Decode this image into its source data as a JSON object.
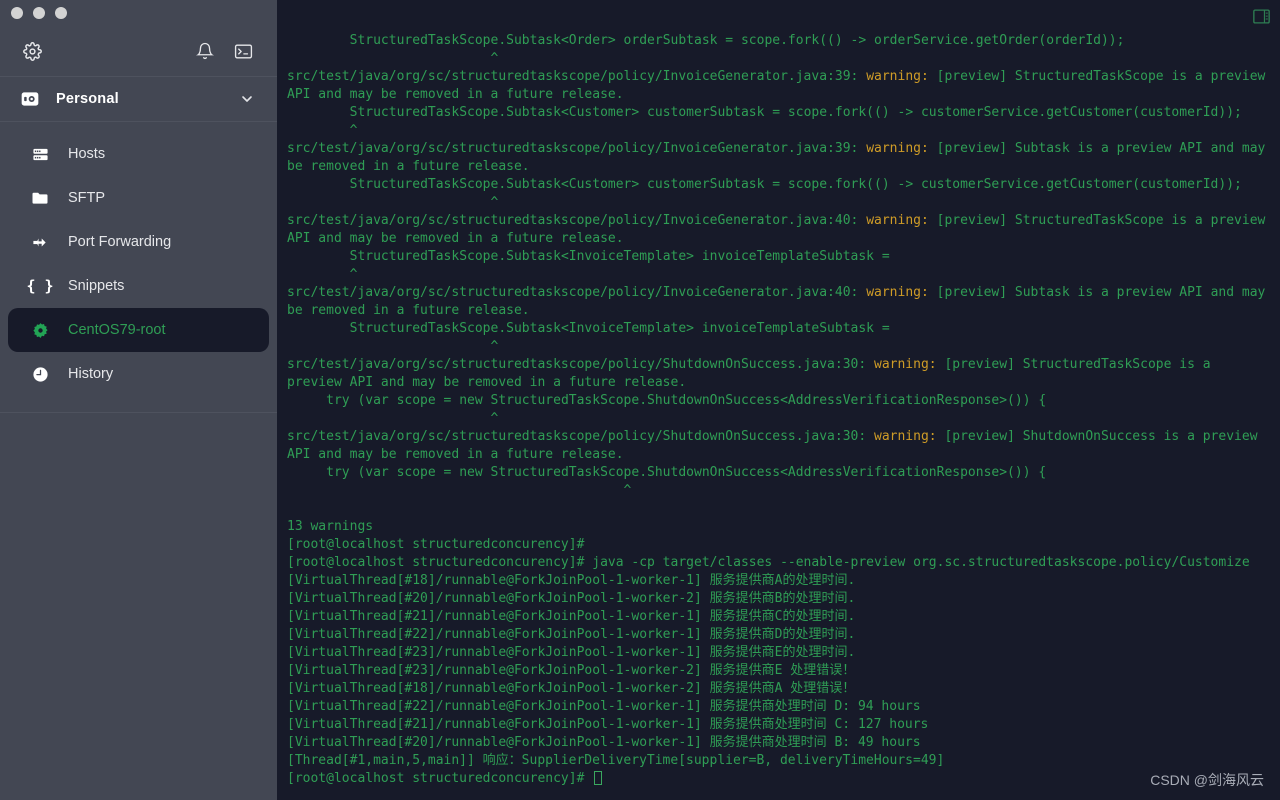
{
  "window": {
    "traffic_lights": [
      "close",
      "minimize",
      "zoom"
    ]
  },
  "sidebar": {
    "toolbar": {
      "settings_icon": "gear-icon",
      "notifications_icon": "bell-icon",
      "terminal_icon": "terminal-icon"
    },
    "account": {
      "label": "Personal",
      "icon": "vault-icon",
      "chevron": "chevron-down-icon"
    },
    "items": [
      {
        "label": "Hosts",
        "icon": "server-icon",
        "active": false
      },
      {
        "label": "SFTP",
        "icon": "folder-icon",
        "active": false
      },
      {
        "label": "Port Forwarding",
        "icon": "port-forwarding-icon",
        "active": false
      },
      {
        "label": "Snippets",
        "icon": "braces-icon",
        "active": false
      },
      {
        "label": "CentOS79-root",
        "icon": "gear-solid-icon",
        "active": true
      },
      {
        "label": "History",
        "icon": "clock-icon",
        "active": false
      }
    ]
  },
  "terminal": {
    "split_icon": "split-pane-icon",
    "colors": {
      "background": "#171a29",
      "foreground": "#2f9e55",
      "warning": "#cf9c27"
    },
    "lines": [
      {
        "text": "        StructuredTaskScope.Subtask<Order> orderSubtask = scope.fork(() -> orderService.getOrder(orderId));"
      },
      {
        "text": "                          ^"
      },
      {
        "text": "src/test/java/org/sc/structuredtaskscope/policy/InvoiceGenerator.java:39: ",
        "warn": "warning:",
        "rest": " [preview] StructuredTaskScope is a preview API and may be removed in a future release."
      },
      {
        "text": "        StructuredTaskScope.Subtask<Customer> customerSubtask = scope.fork(() -> customerService.getCustomer(customerId));"
      },
      {
        "text": "        ^"
      },
      {
        "text": "src/test/java/org/sc/structuredtaskscope/policy/InvoiceGenerator.java:39: ",
        "warn": "warning:",
        "rest": " [preview] Subtask is a preview API and may be removed in a future release."
      },
      {
        "text": "        StructuredTaskScope.Subtask<Customer> customerSubtask = scope.fork(() -> customerService.getCustomer(customerId));"
      },
      {
        "text": "                          ^"
      },
      {
        "text": "src/test/java/org/sc/structuredtaskscope/policy/InvoiceGenerator.java:40: ",
        "warn": "warning:",
        "rest": " [preview] StructuredTaskScope is a preview API and may be removed in a future release."
      },
      {
        "text": "        StructuredTaskScope.Subtask<InvoiceTemplate> invoiceTemplateSubtask ="
      },
      {
        "text": "        ^"
      },
      {
        "text": "src/test/java/org/sc/structuredtaskscope/policy/InvoiceGenerator.java:40: ",
        "warn": "warning:",
        "rest": " [preview] Subtask is a preview API and may be removed in a future release."
      },
      {
        "text": "        StructuredTaskScope.Subtask<InvoiceTemplate> invoiceTemplateSubtask ="
      },
      {
        "text": "                          ^"
      },
      {
        "text": "src/test/java/org/sc/structuredtaskscope/policy/ShutdownOnSuccess.java:30: ",
        "warn": "warning:",
        "rest": " [preview] StructuredTaskScope is a preview API and may be removed in a future release."
      },
      {
        "text": "     try (var scope = new StructuredTaskScope.ShutdownOnSuccess<AddressVerificationResponse>()) {"
      },
      {
        "text": "                          ^"
      },
      {
        "text": "src/test/java/org/sc/structuredtaskscope/policy/ShutdownOnSuccess.java:30: ",
        "warn": "warning:",
        "rest": " [preview] ShutdownOnSuccess is a preview API and may be removed in a future release."
      },
      {
        "text": "     try (var scope = new StructuredTaskScope.ShutdownOnSuccess<AddressVerificationResponse>()) {"
      },
      {
        "text": "                                           ^"
      },
      {
        "text": ""
      },
      {
        "text": "13 warnings"
      },
      {
        "text": "[root@localhost structuredconcurency]#"
      },
      {
        "text": "[root@localhost structuredconcurency]# java -cp target/classes --enable-preview org.sc.structuredtaskscope.policy/Customize"
      },
      {
        "text": "[VirtualThread[#18]/runnable@ForkJoinPool-1-worker-1] 服务提供商A的处理时间."
      },
      {
        "text": "[VirtualThread[#20]/runnable@ForkJoinPool-1-worker-2] 服务提供商B的处理时间."
      },
      {
        "text": "[VirtualThread[#21]/runnable@ForkJoinPool-1-worker-1] 服务提供商C的处理时间."
      },
      {
        "text": "[VirtualThread[#22]/runnable@ForkJoinPool-1-worker-1] 服务提供商D的处理时间."
      },
      {
        "text": "[VirtualThread[#23]/runnable@ForkJoinPool-1-worker-1] 服务提供商E的处理时间."
      },
      {
        "text": "[VirtualThread[#23]/runnable@ForkJoinPool-1-worker-2] 服务提供商E 处理错误！"
      },
      {
        "text": "[VirtualThread[#18]/runnable@ForkJoinPool-1-worker-2] 服务提供商A 处理错误！"
      },
      {
        "text": "[VirtualThread[#22]/runnable@ForkJoinPool-1-worker-1] 服务提供商处理时间 D: 94 hours"
      },
      {
        "text": "[VirtualThread[#21]/runnable@ForkJoinPool-1-worker-1] 服务提供商处理时间 C: 127 hours"
      },
      {
        "text": "[VirtualThread[#20]/runnable@ForkJoinPool-1-worker-1] 服务提供商处理时间 B: 49 hours"
      },
      {
        "text": "[Thread[#1,main,5,main]] 响应：SupplierDeliveryTime[supplier=B, deliveryTimeHours=49]"
      },
      {
        "text": "[root@localhost structuredconcurency]# ",
        "cursor": true
      }
    ]
  },
  "watermark": {
    "text": "CSDN @剑海风云"
  }
}
